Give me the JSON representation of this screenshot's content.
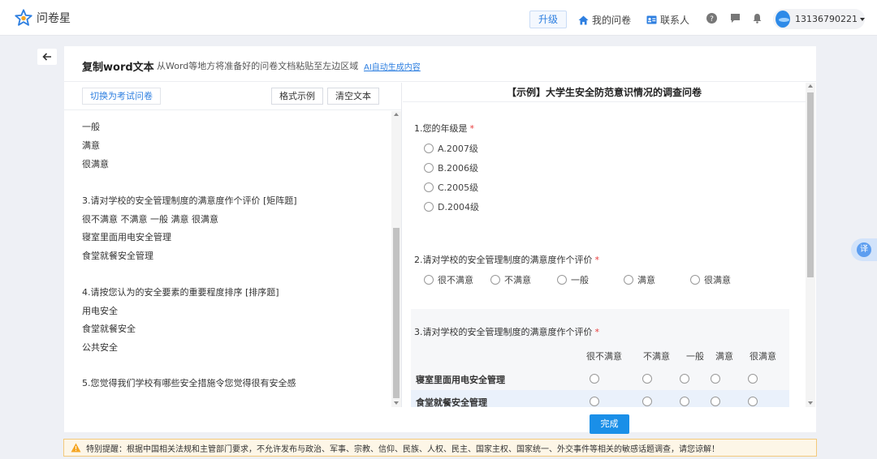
{
  "header": {
    "logo_text": "问卷星",
    "upgrade_label": "升级",
    "nav": {
      "my_surveys": "我的问卷",
      "contacts": "联系人"
    },
    "user": {
      "name": "13136790221"
    }
  },
  "card": {
    "title": "复制word文本",
    "subtitle": "从Word等地方将准备好的问卷文档粘贴至左边区域",
    "ai_link": "AI自动生成内容"
  },
  "editor": {
    "switch_button": "切换为考试问卷",
    "format_example": "格式示例",
    "clear_text": "清空文本",
    "lines": [
      "一般",
      "满意",
      "很满意",
      "",
      "3.请对学校的安全管理制度的满意度作个评价 [矩阵题]",
      "很不满意 不满意 一般 满意 很满意",
      "寝室里面用电安全管理",
      "食堂就餐安全管理",
      "",
      "4.请按您认为的安全要素的重要程度排序 [排序题]",
      "用电安全",
      "食堂就餐安全",
      "公共安全",
      "",
      "5.您觉得我们学校有哪些安全措施令您觉得很有安全感"
    ]
  },
  "preview": {
    "title": "【示例】大学生安全防范意识情况的调查问卷",
    "required_mark": "*",
    "q1": {
      "title": "1.您的年级是",
      "options": [
        "A.2007级",
        "B.2006级",
        "C.2005级",
        "D.2004级"
      ]
    },
    "q2": {
      "title": "2.请对学校的安全管理制度的满意度作个评价",
      "options": [
        "很不满意",
        "不满意",
        "一般",
        "满意",
        "很满意"
      ]
    },
    "q3": {
      "title": "3.请对学校的安全管理制度的满意度作个评价",
      "columns": [
        "很不满意",
        "不满意",
        "一般",
        "满意",
        "很满意"
      ],
      "rows": [
        "寝室里面用电安全管理",
        "食堂就餐安全管理"
      ]
    }
  },
  "finish_label": "完成",
  "translate_label": "译",
  "warning": "特别提醒：根据中国相关法规和主管部门要求，不允许发布与政治、军事、宗教、信仰、民族、人权、民主、国家主权、国家统一、外交事件等相关的敏感话题调查，请您谅解！",
  "colors": {
    "accent": "#1a8fe8",
    "link": "#2e7fe0",
    "required": "#e83b3b",
    "warning_bg": "#fdf6e7"
  }
}
